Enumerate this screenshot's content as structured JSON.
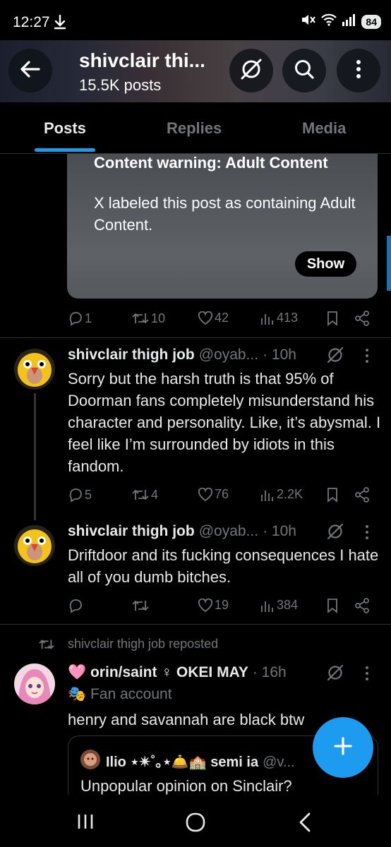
{
  "status_bar": {
    "time": "12:27",
    "download_icon": "download-arrow-icon",
    "battery": "84"
  },
  "header": {
    "title": "shivclair thi...",
    "post_count": "15.5K posts",
    "back_icon": "back-arrow-icon",
    "translate_icon": "grok-icon",
    "search_icon": "search-icon",
    "more_icon": "vertical-dots-icon"
  },
  "tabs": [
    {
      "label": "Posts",
      "active": true
    },
    {
      "label": "Replies",
      "active": false
    },
    {
      "label": "Media",
      "active": false
    }
  ],
  "content_warning": {
    "title": "Content warning: Adult Content",
    "body": "X labeled this post as containing Adult Content.",
    "show_label": "Show"
  },
  "post0_actions": {
    "replies": "1",
    "reposts": "10",
    "likes": "42",
    "views": "413"
  },
  "posts": [
    {
      "name": "shivclair thigh job",
      "handle": "@oyab...",
      "time": "· 10h",
      "text": "Sorry but the harsh truth is that 95% of Doorman fans completely misunderstand his character and personality. Like, it’s abysmal. I feel like I’m surrounded by idiots in this fandom.",
      "replies": "5",
      "reposts": "4",
      "likes": "76",
      "views": "2.2K"
    },
    {
      "name": "shivclair thigh job",
      "handle": "@oyab...",
      "time": "· 10h",
      "text": "Driftdoor and its fucking consequences I hate all of you dumb bitches.",
      "replies": "",
      "reposts": "",
      "likes": "19",
      "views": "384"
    }
  ],
  "repost": {
    "label": "shivclair thigh job reposted",
    "name": "🩷 orin/saint ♀ OKEI MAY",
    "time": "· 16h",
    "badge": "🎭 Fan account",
    "text": "henry and savannah are black btw",
    "quote": {
      "name": "Ilio ⋆✴︎˚｡⋆🛎️🏫 semi ia",
      "handle": "@v...",
      "text": "Unpopular opinion on Sinclair?"
    }
  },
  "fab_icon": "plus-icon",
  "navbar": {
    "recents_icon": "recents-icon",
    "home_icon": "home-icon",
    "back_icon": "nav-back-icon"
  },
  "colors": {
    "accent": "#1d9bf0",
    "muted": "#71767b",
    "background": "#000000"
  }
}
